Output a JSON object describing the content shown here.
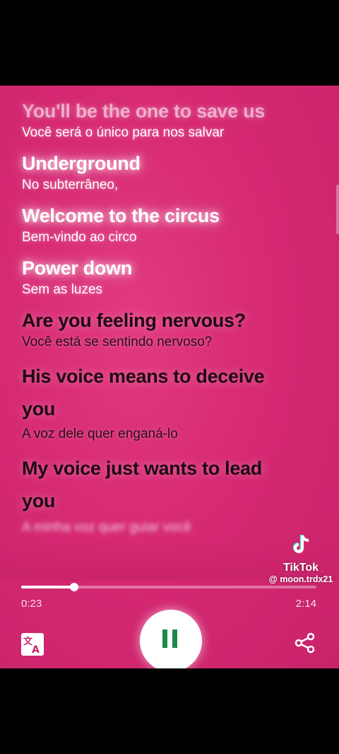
{
  "lyrics": [
    {
      "en": "You'll be the one to save us",
      "pt": "Você será o único para nos salvar"
    },
    {
      "en": "Underground",
      "pt": "No subterrâneo,"
    },
    {
      "en": "Welcome to the circus",
      "pt": "Bem-vindo ao circo"
    },
    {
      "en": "Power down",
      "pt": "Sem as luzes"
    },
    {
      "en": "Are you feeling nervous?",
      "pt": "Você está se sentindo nervoso?"
    },
    {
      "en": "His voice means to deceive",
      "en2": "you",
      "pt": "A voz dele quer enganá-lo"
    },
    {
      "en": "My voice just wants to lead",
      "en2": "you",
      "pt": "A minha voz quer guiar você"
    }
  ],
  "player": {
    "elapsed": "0:23",
    "duration": "2:14",
    "progress_fraction": 0.18,
    "translate_icon": "translate-icon",
    "pause_icon": "pause-icon",
    "share_icon": "share-icon"
  },
  "watermark": {
    "brand": "TikTok",
    "handle": "@ moon.trdx21"
  },
  "colors": {
    "background": "#d62a73",
    "active_text": "#1f0a12",
    "pause_icon": "#1e8a4a"
  }
}
